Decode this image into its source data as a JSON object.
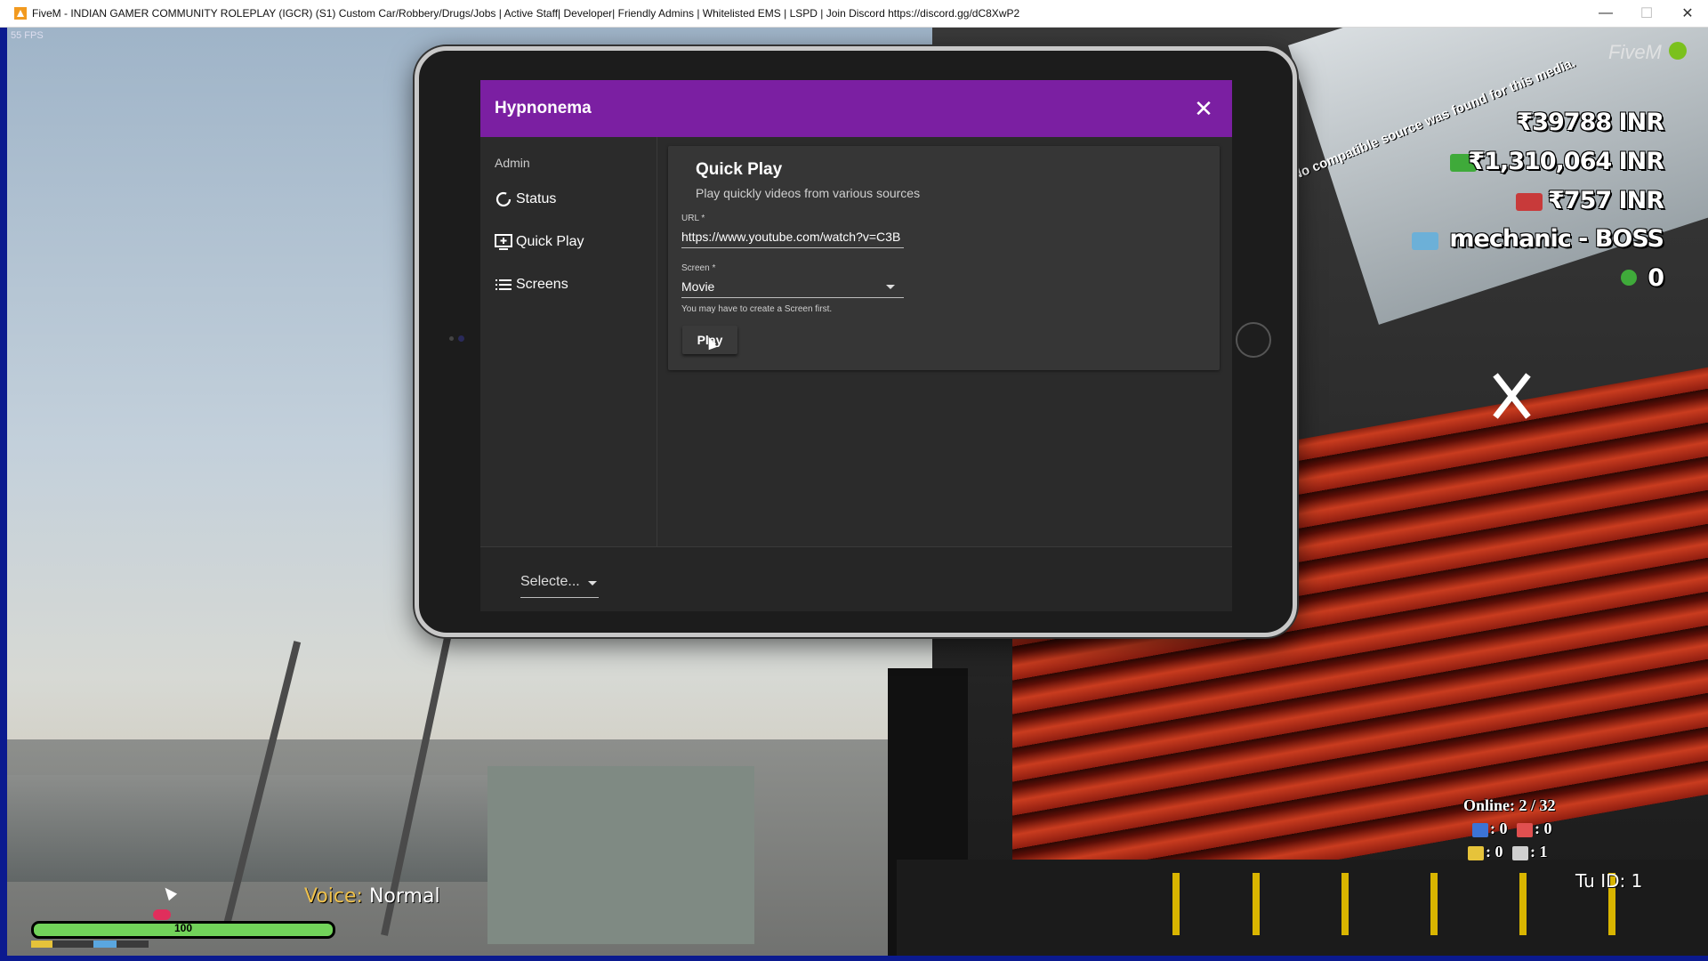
{
  "window": {
    "title": "FiveM - INDIAN GAMER COMMUNITY ROLEPLAY  (IGCR)  (S1)  Custom Car/Robbery/Drugs/Jobs | Active Staff| Developer| Friendly Admins | Whitelisted EMS | LSPD | Join Discord https://discord.gg/dC8XwP2",
    "minimize": "—",
    "maximize": "☐",
    "close": "✕"
  },
  "fps": "55 FPS",
  "app": {
    "title": "Hypnonema",
    "close_icon": "✕",
    "sidebar": {
      "section": "Admin",
      "items": [
        {
          "label": "Status",
          "icon": "loading-circle-icon"
        },
        {
          "label": "Quick Play",
          "icon": "add-to-queue-icon"
        },
        {
          "label": "Screens",
          "icon": "list-icon"
        }
      ]
    },
    "card": {
      "title": "Quick Play",
      "subtitle": "Play quickly videos from various sources",
      "url_label": "URL *",
      "url_value": "https://www.youtube.com/watch?v=C3B",
      "screen_label": "Screen *",
      "screen_value": "Movie",
      "hint": "You may have to create a Screen first.",
      "play_label": "Play"
    },
    "footer": {
      "select_value": "Selecte..."
    }
  },
  "hud": {
    "fivem_label": "FiveM",
    "cash": "₹39788 INR",
    "bank": "₹1,310,064 INR",
    "dirty": "₹757 INR",
    "job": "mechanic - BOSS",
    "coins": "0",
    "scroll_message": "No compatible source was found for this media.",
    "voice_key": "Voice:",
    "voice_value": "Normal",
    "health": "100",
    "online": "Online: 2 / 32",
    "police_count": ": 0",
    "ems_count": ": 0",
    "taxi_count": ": 0",
    "mechanic_count": ": 1",
    "tu_id": "Tu ID: 1"
  },
  "colors": {
    "header_purple": "#7b1fa2",
    "panel_dark": "#2b2b2b",
    "health_green": "#72d35a"
  }
}
